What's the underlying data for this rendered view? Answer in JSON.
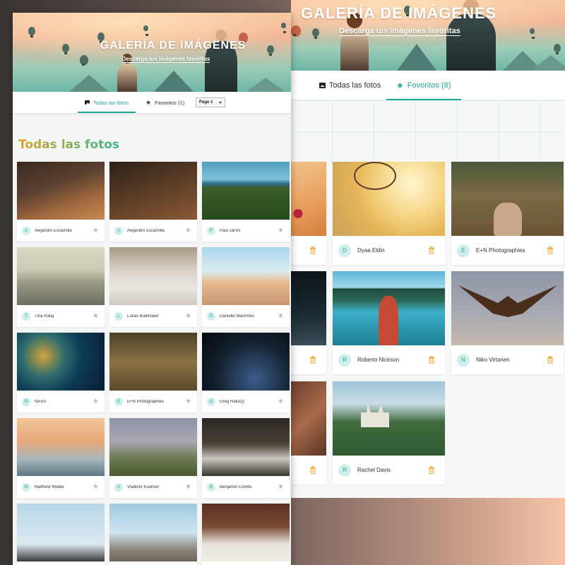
{
  "app": {
    "title": "GALERÍA DE IMÁGENES",
    "subtitle": "Descarga tus imágenes favoritas"
  },
  "left_screen": {
    "tabs": [
      {
        "label": "Todas las fotos",
        "icon": "image-icon",
        "active": true
      },
      {
        "label": "Favoritos (1)",
        "icon": "star-icon",
        "active": false
      }
    ],
    "page_select": {
      "value": "Page 1"
    },
    "section_title": "Todas las fotos",
    "photos": [
      {
        "initial": "A",
        "author": "Alejandro Escamilla"
      },
      {
        "initial": "A",
        "author": "Alejandro Escamilla"
      },
      {
        "initial": "P",
        "author": "Paul Jarvis"
      },
      {
        "initial": "T",
        "author": "Tina Rataj"
      },
      {
        "initial": "L",
        "author": "Lukas Budimaier"
      },
      {
        "initial": "D",
        "author": "Danielle MacInnes"
      },
      {
        "initial": "N",
        "author": "NASA"
      },
      {
        "initial": "E",
        "author": "E+N Photographies"
      },
      {
        "initial": "G",
        "author": "Greg Rakozy"
      },
      {
        "initial": "M",
        "author": "Matthew Wiebe"
      },
      {
        "initial": "V",
        "author": "Vladimir Kudinov"
      },
      {
        "initial": "B",
        "author": "Benjamin Combs"
      }
    ]
  },
  "right_screen": {
    "tabs": [
      {
        "label": "Todas las fotos",
        "icon": "image-icon",
        "active": false
      },
      {
        "label": "Fovoritos (8)",
        "icon": "star-icon",
        "active": true
      }
    ],
    "favorites": [
      {
        "initial": "D",
        "author": "Dyaa Eldin"
      },
      {
        "initial": "E",
        "author": "E+N Photographies"
      },
      {
        "initial": "R",
        "author": "Roberto Nickson"
      },
      {
        "initial": "N",
        "author": "Niko Virtanen"
      },
      {
        "initial": "R",
        "author": "Rachel Davis"
      }
    ]
  },
  "colors": {
    "accent": "#1ea79b",
    "trash": "#f2a93b",
    "avatar_bg": "#cdeeea"
  }
}
